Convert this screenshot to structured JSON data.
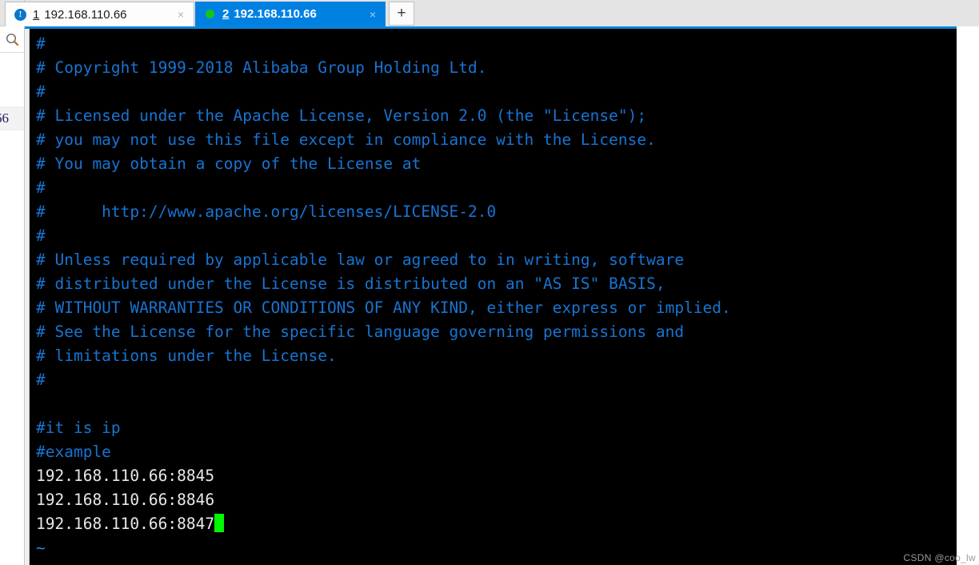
{
  "rail": {
    "close_label": "✕",
    "search_icon": "search-icon",
    "session_label": "66"
  },
  "tabbar": {
    "new_tab_label": "+",
    "close_glyph": "×",
    "tabs": [
      {
        "index": "1",
        "title": "192.168.110.66",
        "status": "alert",
        "status_glyph": "!",
        "active": false
      },
      {
        "index": "2",
        "title": "192.168.110.66",
        "status": "connected",
        "status_glyph": "",
        "active": true
      }
    ]
  },
  "terminal": {
    "background": "#000000",
    "comment_color": "#1874d2",
    "text_color": "#e8e8e8",
    "cursor_color": "#00f900",
    "lines": [
      {
        "text": "#",
        "style": "comment"
      },
      {
        "text": "# Copyright 1999-2018 Alibaba Group Holding Ltd.",
        "style": "comment"
      },
      {
        "text": "#",
        "style": "comment"
      },
      {
        "text": "# Licensed under the Apache License, Version 2.0 (the \"License\");",
        "style": "comment"
      },
      {
        "text": "# you may not use this file except in compliance with the License.",
        "style": "comment"
      },
      {
        "text": "# You may obtain a copy of the License at",
        "style": "comment"
      },
      {
        "text": "#",
        "style": "comment"
      },
      {
        "text": "#      http://www.apache.org/licenses/LICENSE-2.0",
        "style": "comment"
      },
      {
        "text": "#",
        "style": "comment"
      },
      {
        "text": "# Unless required by applicable law or agreed to in writing, software",
        "style": "comment"
      },
      {
        "text": "# distributed under the License is distributed on an \"AS IS\" BASIS,",
        "style": "comment"
      },
      {
        "text": "# WITHOUT WARRANTIES OR CONDITIONS OF ANY KIND, either express or implied.",
        "style": "comment"
      },
      {
        "text": "# See the License for the specific language governing permissions and",
        "style": "comment"
      },
      {
        "text": "# limitations under the License.",
        "style": "comment"
      },
      {
        "text": "#",
        "style": "comment"
      },
      {
        "text": "",
        "style": "comment"
      },
      {
        "text": "#it is ip",
        "style": "comment"
      },
      {
        "text": "#example",
        "style": "comment"
      },
      {
        "text": "192.168.110.66:8845",
        "style": "text"
      },
      {
        "text": "192.168.110.66:8846",
        "style": "text"
      },
      {
        "text": "192.168.110.66:8847",
        "style": "text",
        "cursor": true
      },
      {
        "text": "~",
        "style": "tilde"
      }
    ]
  },
  "watermark": {
    "text": "CSDN @coo_lw"
  }
}
